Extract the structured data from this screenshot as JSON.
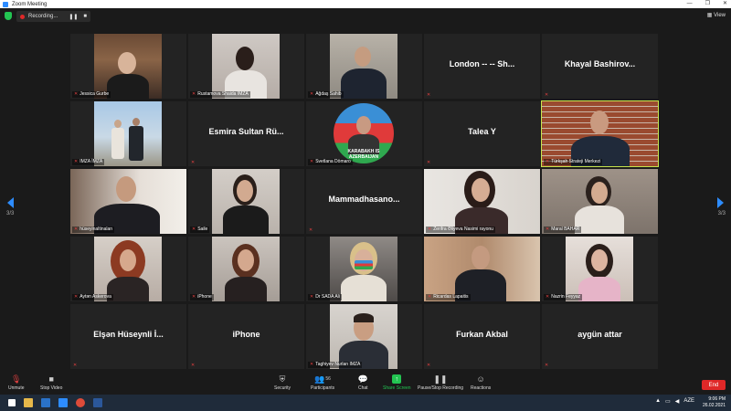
{
  "window": {
    "title": "Zoom Meeting",
    "buttons": [
      "—",
      "❐",
      "✕"
    ]
  },
  "topbar": {
    "recording_label": "Recording...",
    "pause": "❚❚",
    "stop": "■",
    "view_label": "View"
  },
  "pager": {
    "left": "3/3",
    "right": "3/3"
  },
  "tiles": [
    {
      "name": "Jessica Gurbe",
      "video": true
    },
    {
      "name": "Rustamova Shaida IMZA",
      "video": true
    },
    {
      "name": "Ağdaş Sahib",
      "video": true
    },
    {
      "name": "",
      "display_name": "London --  -- Sh...",
      "video": false
    },
    {
      "name": "",
      "display_name": "Khayal Bashirov...",
      "video": false
    },
    {
      "name": "IMZA İMZA",
      "video": true
    },
    {
      "name": "",
      "display_name": "Esmira Sultan Rü...",
      "video": false
    },
    {
      "name": "Svetlana Dömaro",
      "video": true,
      "overlay": "KARABAKH IS AZERBAIJAN"
    },
    {
      "name": "",
      "display_name": "Talea Y",
      "video": false
    },
    {
      "name": "Türkşah Strateji Merkezi",
      "video": true,
      "speaking": true
    },
    {
      "name": "hüseyinaltinalan",
      "video": true
    },
    {
      "name": "Saile",
      "video": true
    },
    {
      "name": "",
      "display_name": "Mammadhasano...",
      "video": false
    },
    {
      "name": "Zerifra Əliyeva Nasimi rayonu",
      "video": true
    },
    {
      "name": "Maral BAHAR",
      "video": true
    },
    {
      "name": "Aytən Askerova",
      "video": true
    },
    {
      "name": "iPhone",
      "video": true
    },
    {
      "name": "Dr SADA Ali",
      "video": true
    },
    {
      "name": "Ricardas Lapaitis",
      "video": true
    },
    {
      "name": "Nazrin Feyyaz",
      "video": true
    },
    {
      "name": "",
      "display_name": "Elşən Hüseynli İ...",
      "video": false
    },
    {
      "name": "",
      "display_name": "iPhone",
      "video": false
    },
    {
      "name": "Taghiyev Nurlan IMZA",
      "video": true
    },
    {
      "name": "",
      "display_name": "Furkan Akbal",
      "video": false
    },
    {
      "name": "",
      "display_name": "aygün attar",
      "video": false
    }
  ],
  "toolbar": {
    "unmute": "Unmute",
    "stop_video": "Stop Video",
    "security": "Security",
    "participants": "Participants",
    "participants_count": "56",
    "chat": "Chat",
    "share_screen": "Share Screen",
    "recording": "Pause/Stop Recording",
    "reactions": "Reactions",
    "end": "End"
  },
  "taskbar": {
    "time": "9:06 PM",
    "date": "26.02.2021",
    "lang": "AZE"
  },
  "colors": {
    "accent": "#2d8cff",
    "speaking": "#c8e64d",
    "end": "#e02828",
    "share": "#23c552"
  }
}
